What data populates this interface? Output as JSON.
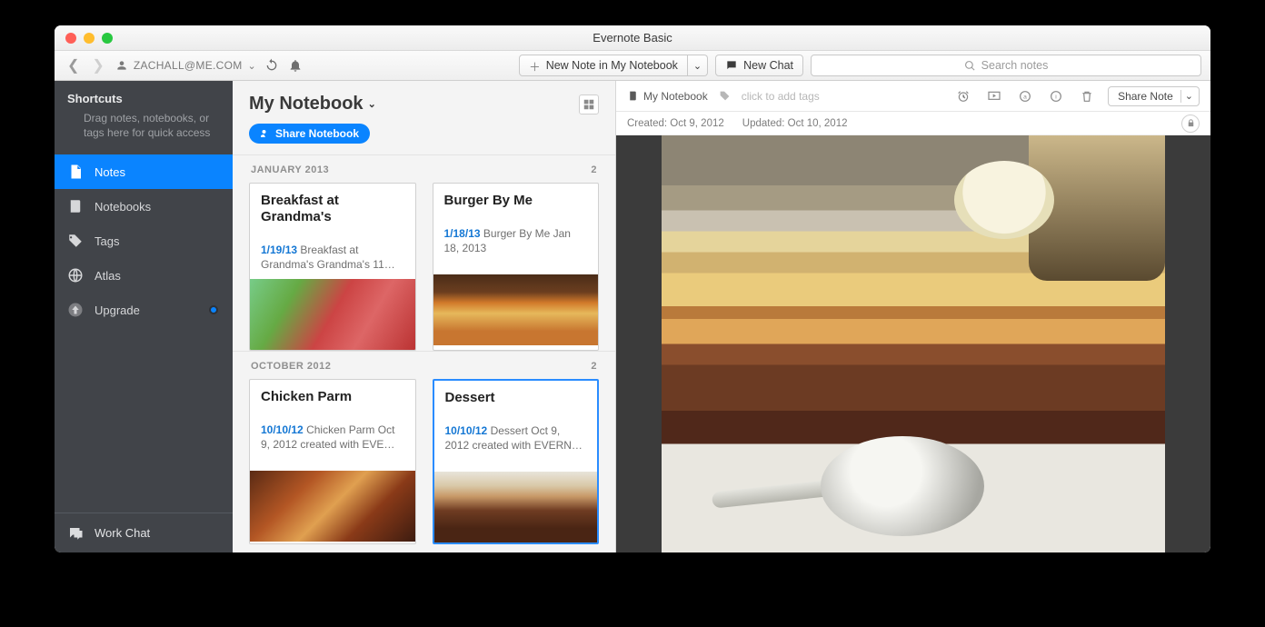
{
  "window": {
    "title": "Evernote Basic"
  },
  "toolbar": {
    "account": "ZACHALL@ME.COM",
    "new_note": "New Note in My Notebook",
    "new_chat": "New Chat",
    "search_placeholder": "Search notes"
  },
  "sidebar": {
    "shortcuts": {
      "title": "Shortcuts",
      "hint": "Drag notes, notebooks, or tags here for quick access"
    },
    "items": [
      {
        "label": "Notes",
        "active": true
      },
      {
        "label": "Notebooks"
      },
      {
        "label": "Tags"
      },
      {
        "label": "Atlas"
      },
      {
        "label": "Upgrade",
        "badge": true
      }
    ],
    "workchat": "Work Chat"
  },
  "notebook": {
    "title": "My Notebook",
    "share": "Share Notebook",
    "sections": [
      {
        "label": "JANUARY 2013",
        "count": "2",
        "notes": [
          {
            "title": "Breakfast at Grandma's",
            "date": "1/19/13",
            "snippet": "Breakfast at Grandma's Grandma's 11…",
            "thumb": "t1"
          },
          {
            "title": "Burger By Me",
            "date": "1/18/13",
            "snippet": "Burger By Me Jan 18, 2013",
            "thumb": "t2"
          }
        ]
      },
      {
        "label": "OCTOBER 2012",
        "count": "2",
        "notes": [
          {
            "title": "Chicken Parm",
            "date": "10/10/12",
            "snippet": "Chicken Parm Oct 9, 2012 created with EVE…",
            "thumb": "t3"
          },
          {
            "title": "Dessert",
            "date": "10/10/12",
            "snippet": "Dessert Oct 9, 2012 created with EVERN…",
            "thumb": "t4",
            "selected": true
          }
        ]
      }
    ]
  },
  "note": {
    "notebook_label": "My Notebook",
    "tag_placeholder": "click to add tags",
    "share": "Share Note",
    "created": "Created: Oct 9, 2012",
    "updated": "Updated: Oct 10, 2012"
  }
}
